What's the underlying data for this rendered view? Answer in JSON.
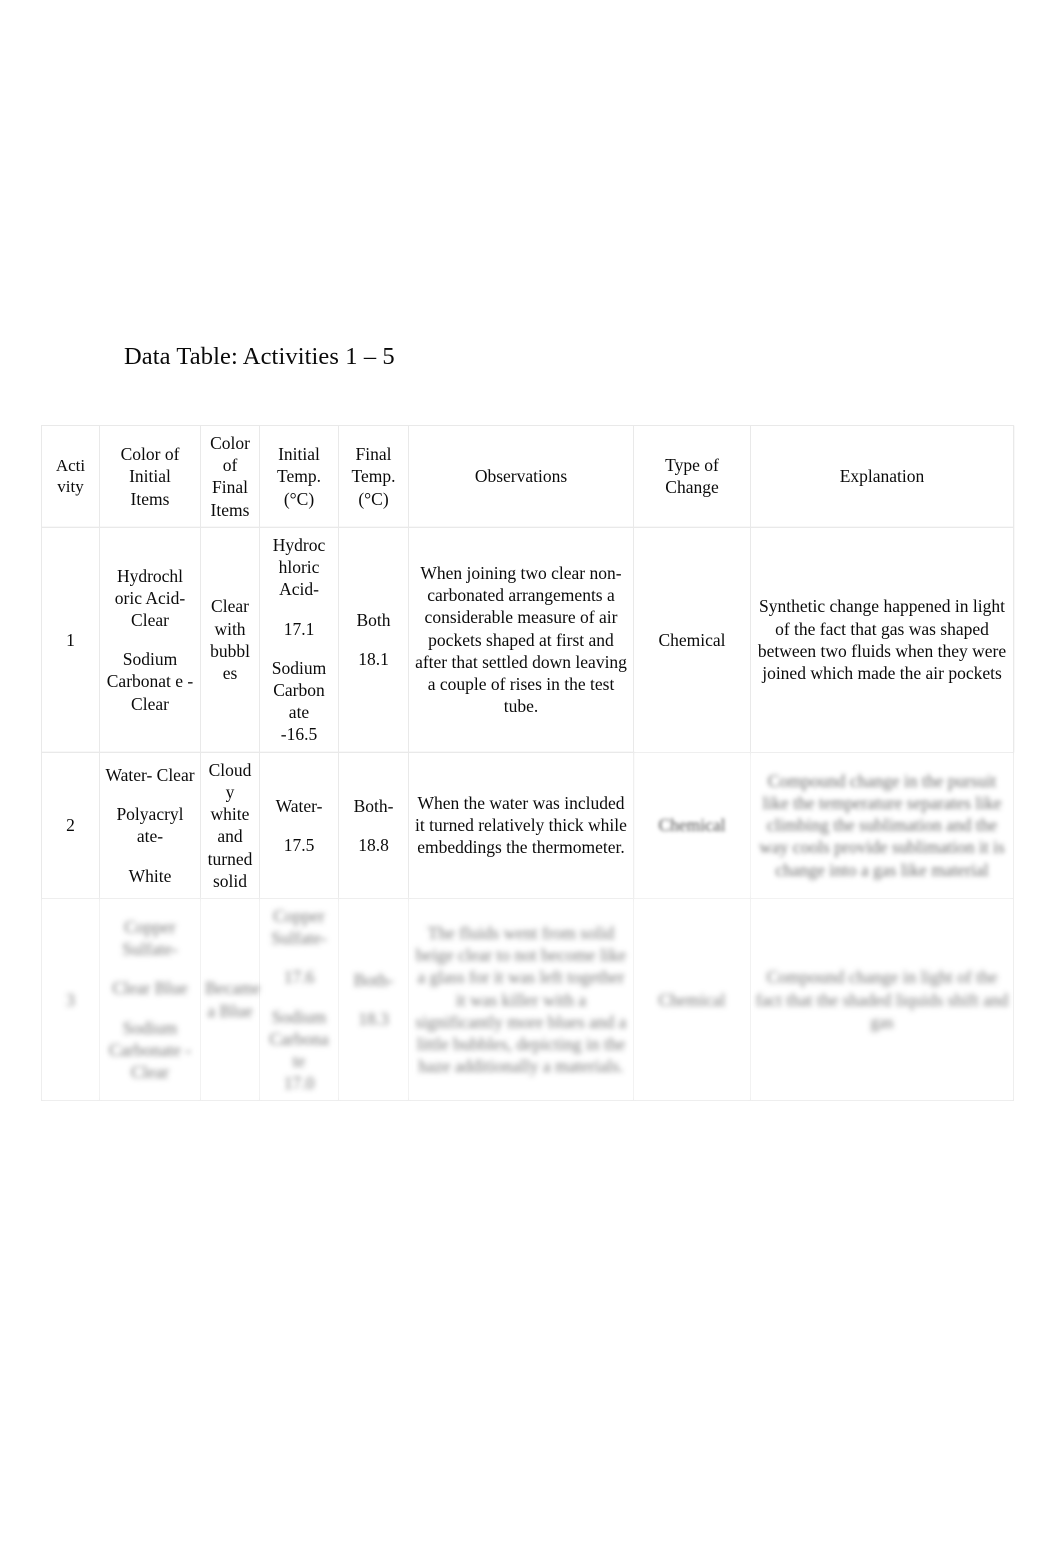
{
  "document": {
    "title": "Data Table: Activities 1 – 5"
  },
  "table": {
    "headers": [
      "Acti vity",
      "Color of Initial Items",
      "Color of Final Items",
      "Initial Temp. (°C)",
      "Final Temp. (°C)",
      "Observations",
      "Type of Change",
      "Explanation"
    ],
    "header_parts": {
      "activity": [
        "Acti",
        "vity"
      ],
      "color_initial": [
        "Color of",
        "Initial",
        "Items"
      ],
      "color_final": [
        "Color",
        "of",
        "Final",
        "Items"
      ],
      "initial_temp": [
        "Initial",
        "Temp.",
        "(°C)"
      ],
      "final_temp": [
        "Final",
        "Temp.",
        "(°C)"
      ],
      "observations": [
        "Observations"
      ],
      "type_of_change": [
        "Type of",
        "Change"
      ],
      "explanation": [
        "Explanation"
      ]
    },
    "rows": [
      {
        "activity": "1",
        "color_initial_a": "Hydrochl oric Acid- Clear",
        "color_initial_b": "Sodium Carbonat e -Clear",
        "color_final": "Clear with bubbl es",
        "initial_temp_a": "Hydroc hloric Acid-",
        "initial_temp_a_value": "17.1",
        "initial_temp_b": "Sodium Carbon ate",
        "initial_temp_b_value": "-16.5",
        "final_temp_label": "Both",
        "final_temp_value": "18.1",
        "observations": "When joining two clear non-carbonated arrangements a considerable measure of air pockets shaped at first and after that settled down leaving a couple of rises in the test tube.",
        "type_of_change": "Chemical",
        "explanation": "Synthetic change happened in light of the fact that gas was shaped between two fluids when they were joined which made the air pockets"
      },
      {
        "activity": "2",
        "color_initial_a": "Water- Clear",
        "color_initial_b": "Polyacryl ate-",
        "color_initial_c": "White",
        "color_final": "Cloud y white and turned solid",
        "initial_temp_label": "Water-",
        "initial_temp_value": "17.5",
        "final_temp_label": "Both-",
        "final_temp_value": "18.8",
        "observations": "When the water was included it turned relatively thick while embeddings the thermometer.",
        "type_of_change": "Chemical",
        "explanation": "Compound change in the pursuit like the temperature separates like climbing the sublimation and the way cools provide sublimation it is change into a gas like material"
      },
      {
        "activity": "3",
        "color_initial_a": "Copper Sulfate-",
        "color_initial_b": "Clear Blue",
        "color_initial_c": "Sodium Carbonate -Clear",
        "color_final": "Became a Blue",
        "initial_temp_a": "Copper Sulfate-",
        "initial_temp_a_value": "17.6",
        "initial_temp_b": "Sodium Carbona te",
        "initial_temp_b_value": "17.0",
        "final_temp_label": "Both-",
        "final_temp_value": "18.3",
        "observations": "The fluids went from solid beige clear to not become like a glass for it was left together it was killer with a significantly more blues and a little bubbles, depicting in the haze additionally a materials.",
        "type_of_change": "Chemical",
        "explanation": "Compound change in light of the fact that the shaded liquids shift and gas"
      }
    ]
  }
}
